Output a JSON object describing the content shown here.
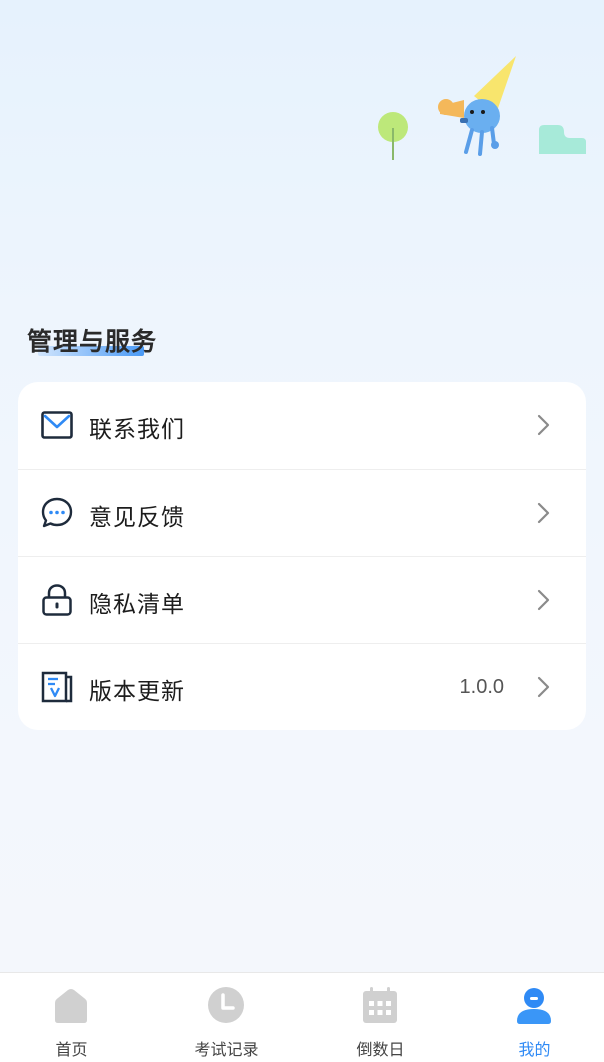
{
  "section": {
    "title": "管理与服务"
  },
  "menu": [
    {
      "label": "联系我们",
      "icon": "mail-icon",
      "value": ""
    },
    {
      "label": "意见反馈",
      "icon": "chat-bubble-icon",
      "value": ""
    },
    {
      "label": "隐私清单",
      "icon": "lock-icon",
      "value": ""
    },
    {
      "label": "版本更新",
      "icon": "version-document-icon",
      "value": "1.0.0"
    }
  ],
  "tabs": [
    {
      "label": "首页",
      "icon": "home-icon",
      "active": false
    },
    {
      "label": "考试记录",
      "icon": "clock-icon",
      "active": false
    },
    {
      "label": "倒数日",
      "icon": "calendar-icon",
      "active": false
    },
    {
      "label": "我的",
      "icon": "user-icon",
      "active": true
    }
  ],
  "colors": {
    "accent": "#2f8af5",
    "icon_dark": "#1e2b3c",
    "inactive_icon": "#d0d0d0"
  }
}
